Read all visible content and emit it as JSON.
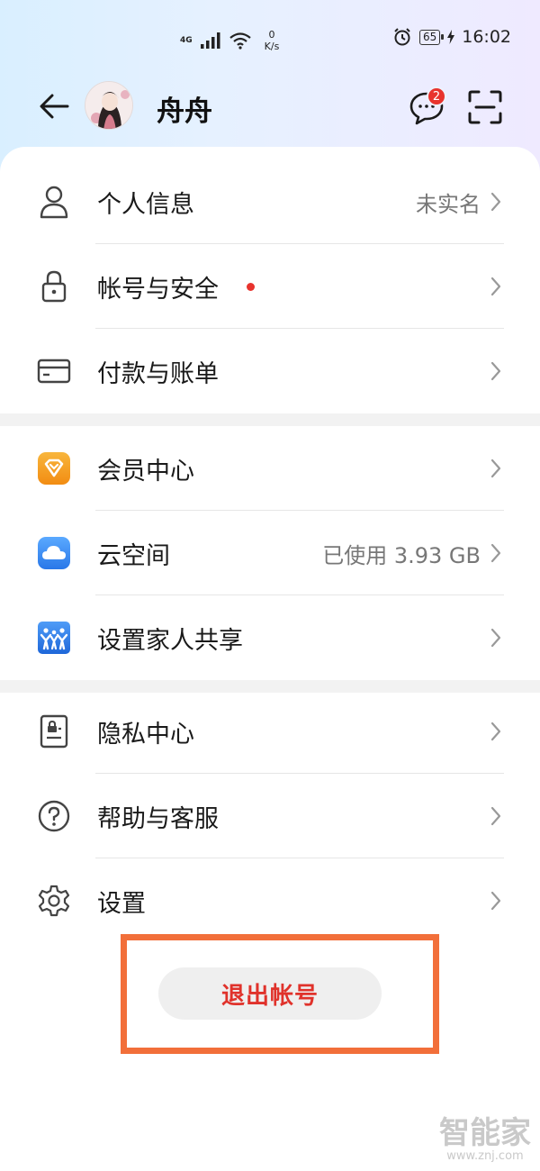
{
  "status_bar": {
    "network": "4G",
    "speed_value": "0",
    "speed_unit": "K/s",
    "battery": "65",
    "time": "16:02"
  },
  "header": {
    "user_name": "舟舟",
    "message_badge": "2"
  },
  "menu": {
    "personal_info": {
      "label": "个人信息",
      "value": "未实名"
    },
    "account_security": {
      "label": "帐号与安全"
    },
    "payment": {
      "label": "付款与账单"
    },
    "membership": {
      "label": "会员中心"
    },
    "cloud": {
      "label": "云空间",
      "value": "已使用 3.93 GB"
    },
    "family_share": {
      "label": "设置家人共享"
    },
    "privacy": {
      "label": "隐私中心"
    },
    "help": {
      "label": "帮助与客服"
    },
    "settings": {
      "label": "设置"
    }
  },
  "logout": {
    "label": "退出帐号"
  },
  "watermark": {
    "title": "智能家",
    "url": "www.znj.com"
  },
  "colors": {
    "accent_red": "#e0322b",
    "highlight_frame": "#f26f3a",
    "member_orange": "#f59a1a",
    "cloud_blue": "#3d8ef2",
    "family_blue": "#2f7de6"
  }
}
